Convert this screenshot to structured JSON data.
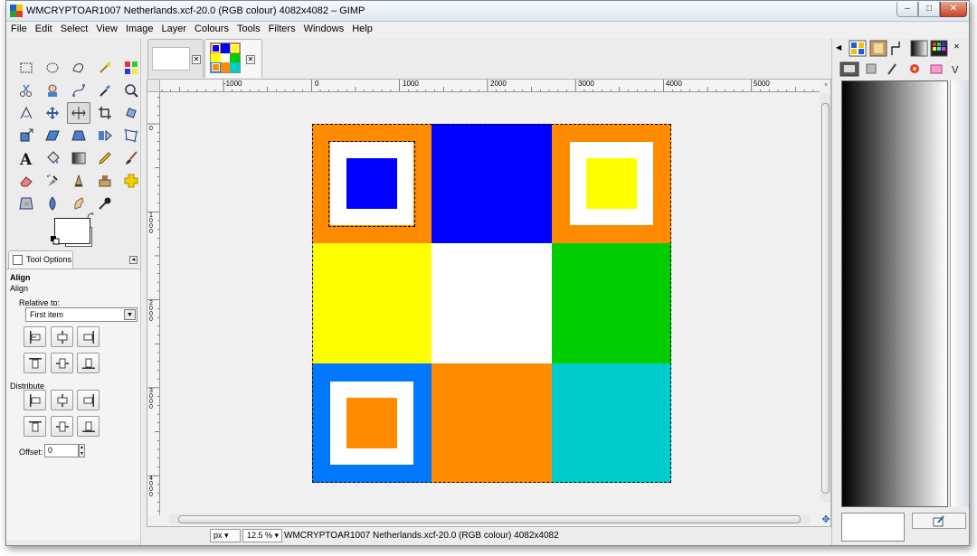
{
  "window": {
    "title": "WMCRYPTOAR1007 Netherlands.xcf-20.0 (RGB colour) 4082x4082 – GIMP",
    "controls": {
      "minimize": "–",
      "maximize": "□",
      "close": "✕"
    }
  },
  "menubar": {
    "items": [
      {
        "label": "File"
      },
      {
        "label": "Edit"
      },
      {
        "label": "Select"
      },
      {
        "label": "View"
      },
      {
        "label": "Image"
      },
      {
        "label": "Layer"
      },
      {
        "label": "Colours"
      },
      {
        "label": "Tools"
      },
      {
        "label": "Filters"
      },
      {
        "label": "Windows"
      },
      {
        "label": "Help"
      }
    ]
  },
  "toolbox": {
    "tools": [
      {
        "icon": "rect-select-icon"
      },
      {
        "icon": "ellipse-select-icon"
      },
      {
        "icon": "free-select-icon"
      },
      {
        "icon": "fuzzy-select-icon"
      },
      {
        "icon": "color-select-icon"
      },
      {
        "icon": "scissors-select-icon"
      },
      {
        "icon": "foreground-select-icon"
      },
      {
        "icon": "paths-icon"
      },
      {
        "icon": "color-picker-icon"
      },
      {
        "icon": "zoom-icon"
      },
      {
        "icon": "measure-icon"
      },
      {
        "icon": "move-icon"
      },
      {
        "icon": "align-icon"
      },
      {
        "icon": "crop-icon"
      },
      {
        "icon": "rotate-icon"
      },
      {
        "icon": "scale-icon"
      },
      {
        "icon": "shear-icon"
      },
      {
        "icon": "perspective-icon"
      },
      {
        "icon": "flip-icon"
      },
      {
        "icon": "cage-icon"
      },
      {
        "icon": "text-icon"
      },
      {
        "icon": "bucket-fill-icon"
      },
      {
        "icon": "blend-icon"
      },
      {
        "icon": "pencil-icon"
      },
      {
        "icon": "paintbrush-icon"
      },
      {
        "icon": "eraser-icon"
      },
      {
        "icon": "airbrush-icon"
      },
      {
        "icon": "ink-icon"
      },
      {
        "icon": "clone-icon"
      },
      {
        "icon": "heal-icon"
      },
      {
        "icon": "perspective-clone-icon"
      },
      {
        "icon": "blur-icon"
      },
      {
        "icon": "smudge-icon"
      },
      {
        "icon": "dodge-burn-icon"
      }
    ],
    "active_tool": "align-icon"
  },
  "tool_options": {
    "tab_label": "Tool Options",
    "title": "Align",
    "subtitle": "Align",
    "relative_to_label": "Relative to:",
    "relative_to_value": "First item",
    "distribute_label": "Distribute",
    "offset_label": "Offset:",
    "offset_value": "0"
  },
  "image_tabs": [
    {
      "name": "blank-image"
    },
    {
      "name": "netherlands-image"
    }
  ],
  "rulers": {
    "h_labels": [
      "-1000",
      "0",
      "1000",
      "2000",
      "3000",
      "4000",
      "5000"
    ],
    "v_labels": [
      "0",
      "1000",
      "2000",
      "3000",
      "4000"
    ]
  },
  "image": {
    "cells": [
      {
        "bg": "#ff8c00",
        "frame": "#ffffff",
        "center": "#0000ff"
      },
      {
        "bg": "#0000ff"
      },
      {
        "bg": "#ff8c00",
        "frame": "#ffffff",
        "center": "#ffff00"
      },
      {
        "bg": "#ffff00"
      },
      {
        "bg": "#ffffff"
      },
      {
        "bg": "#00cc00"
      },
      {
        "bg": "#0077ff",
        "frame": "#ffffff",
        "center": "#ff8c00"
      },
      {
        "bg": "#ff8c00"
      },
      {
        "bg": "#00cccc"
      }
    ]
  },
  "statusbar": {
    "unit": "px",
    "zoom": "12.5 %",
    "text": "WMCRYPTOAR1007 Netherlands.xcf-20.0 (RGB colour) 4082x4082"
  },
  "colors": {
    "accent": "#2a5fb0",
    "window_bg": "#ececec"
  }
}
